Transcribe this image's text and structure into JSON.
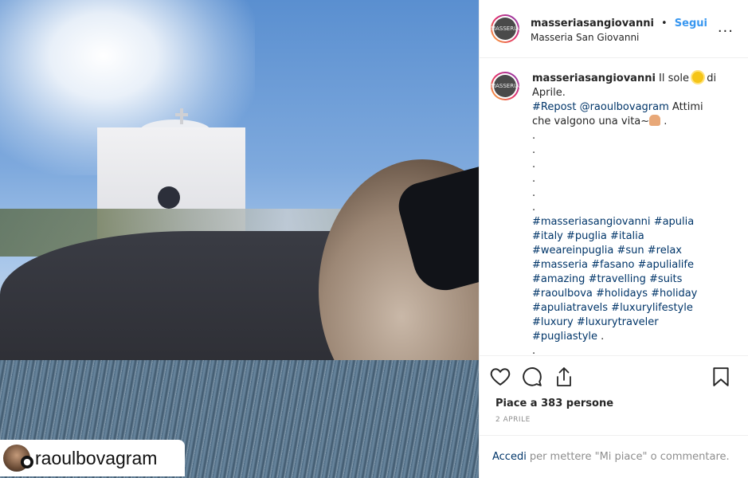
{
  "photo": {
    "repost_username": "raoulbovagram",
    "repost_avatar_icon": "user-icon"
  },
  "header": {
    "username": "masseriasangiovanni",
    "dot": "•",
    "follow_label": "Segui",
    "location": "Masseria San Giovanni",
    "more_label": "...",
    "avatar_logo_text": "MASSERIA"
  },
  "caption": {
    "username": "masseriasangiovanni",
    "text_before_emoji": " Il sole ",
    "sun_icon": "sun-emoji",
    "text_after_emoji": " di Aprile.",
    "repost_tag": "#Repost",
    "mention": "@raoulbovagram",
    "line2_text": " Attimi che valgono una vita~",
    "pray_icon": "pray-emoji",
    "line2_end": " .",
    "dots": [
      ".",
      ".",
      ".",
      ".",
      ".",
      "."
    ],
    "hashtags": [
      "#masseriasangiovanni",
      "#apulia",
      "#italy",
      "#puglia",
      "#italia",
      "#weareinpuglia",
      "#sun",
      "#relax",
      "#masseria",
      "#fasano",
      "#apulialife",
      "#amazing",
      "#travelling",
      "#suits",
      "#raoulbova",
      "#holidays",
      "#holiday",
      "#apuliatravels",
      "#luxurylifestyle",
      "#luxury",
      "#luxurytraveler",
      "#pugliastyle"
    ],
    "hashtags_end": " .",
    "final_dot": "."
  },
  "actions": {
    "like_icon": "heart-icon",
    "comment_icon": "comment-icon",
    "share_icon": "share-icon",
    "save_icon": "bookmark-icon",
    "likes_text": "Piace a 383 persone",
    "date": "2 APRILE"
  },
  "login": {
    "link_label": "Accedi",
    "rest_text": "per mettere \"Mi piace\" o commentare."
  }
}
